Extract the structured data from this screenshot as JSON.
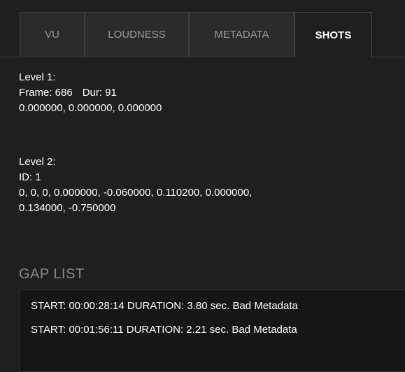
{
  "tabs": [
    {
      "label": "VU",
      "active": false
    },
    {
      "label": "LOUDNESS",
      "active": false
    },
    {
      "label": "METADATA",
      "active": false
    },
    {
      "label": "SHOTS",
      "active": true
    }
  ],
  "level1": {
    "title": "Level 1:",
    "frame": "Frame: 686",
    "dur": "Dur: 91",
    "values": "0.000000, 0.000000, 0.000000"
  },
  "level2": {
    "title": "Level 2:",
    "id": "ID: 1",
    "values_line1": "0, 0, 0, 0.000000, -0.060000, 0.110200, 0.000000,",
    "values_line2": "0.134000, -0.750000"
  },
  "gap_list": {
    "title": "GAP LIST",
    "items": [
      "START: 00:00:28:14 DURATION: 3.80 sec.  Bad Metadata",
      "START: 00:01:56:11 DURATION: 2.21 sec.  Bad Metadata"
    ]
  },
  "colors": {
    "background": "#1f1f1f",
    "tab_inactive_bg": "#2b2b2b",
    "tab_inactive_text": "#9a9a9a",
    "section_title": "#8a8a8a",
    "list_bg": "#161616"
  }
}
